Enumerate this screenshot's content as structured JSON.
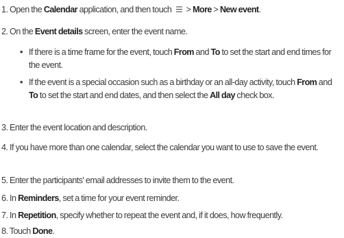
{
  "steps": [
    {
      "num": "1.",
      "pre": " Open the ",
      "b1": "Calendar",
      "mid": " application, and then touch ",
      "icon": "menu-icon",
      "sep1": " > ",
      "b2": "More",
      "sep2": " > ",
      "b3": "New event",
      "end": "."
    },
    {
      "num": "2.",
      "pre": " On the ",
      "b1": "Event details",
      "end": " screen, enter the event name."
    },
    {
      "num": "3.",
      "text": " Enter the event location and description."
    },
    {
      "num": "4.",
      "text": " If you have more than one calendar, select the calendar you want to use to save the event."
    },
    {
      "num": "5.",
      "text": " Enter the participants' email addresses to invite them to the event."
    },
    {
      "num": "6.",
      "pre": " In ",
      "b1": "Reminders",
      "end": ", set a time for your event reminder."
    },
    {
      "num": "7.",
      "pre": " In ",
      "b1": "Repetition",
      "end": ", specify whether to repeat the event and, if it does, how frequently."
    },
    {
      "num": "8.",
      "pre": " Touch ",
      "b1": "Done",
      "end": "."
    }
  ],
  "bullets": [
    {
      "dot": "•",
      "t1": "If there is a time frame for the event, touch ",
      "b1": "From",
      "t2": " and ",
      "b2": "To",
      "t3": " to set the start and end times for the event."
    },
    {
      "dot": "•",
      "t1": "If the event is a special occasion such as a birthday or an all-day activity, touch ",
      "b1": "From",
      "t2": " and ",
      "b2": "To",
      "t3": " to set the start and end dates, and then select the ",
      "b3": "All day",
      "t4": " check box."
    }
  ]
}
